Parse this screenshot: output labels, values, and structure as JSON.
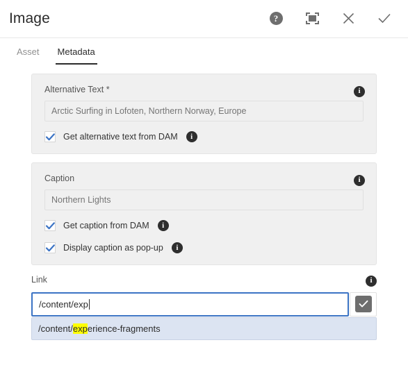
{
  "header": {
    "title": "Image",
    "actions": [
      {
        "name": "help-icon",
        "label": "Help"
      },
      {
        "name": "fullscreen-icon",
        "label": "Fullscreen"
      },
      {
        "name": "close-icon",
        "label": "Close"
      },
      {
        "name": "confirm-icon",
        "label": "Done"
      }
    ]
  },
  "tabs": [
    {
      "label": "Asset",
      "active": false
    },
    {
      "label": "Metadata",
      "active": true
    }
  ],
  "groups": {
    "alt_text": {
      "label": "Alternative Text *",
      "input_placeholder": "Arctic Surfing in Lofoten, Northern Norway, Europe",
      "input_value": "",
      "checkbox": {
        "label": "Get alternative text from DAM",
        "checked": true
      }
    },
    "caption": {
      "label": "Caption",
      "input_placeholder": "Northern Lights",
      "input_value": "",
      "checkbox_1": {
        "label": "Get caption from DAM",
        "checked": true
      },
      "checkbox_2": {
        "label": "Display caption as pop-up",
        "checked": true
      }
    }
  },
  "link": {
    "label": "Link",
    "value": "/content/exp",
    "placeholder": "",
    "picker_button_label": "Select path",
    "suggestions": [
      {
        "prefix": "/content/",
        "match": "exp",
        "suffix": "erience-fragments",
        "full": "/content/experience-fragments"
      }
    ]
  },
  "colors": {
    "accent_focus": "#3b73c4",
    "checkbox_check": "#3b73c4",
    "highlight": "#ffff00",
    "dropdown_bg": "#dce4f2",
    "field_bg": "#f0f0f0",
    "icon_dark": "#2e2e2e",
    "icon_gray": "#6e6e6e"
  }
}
